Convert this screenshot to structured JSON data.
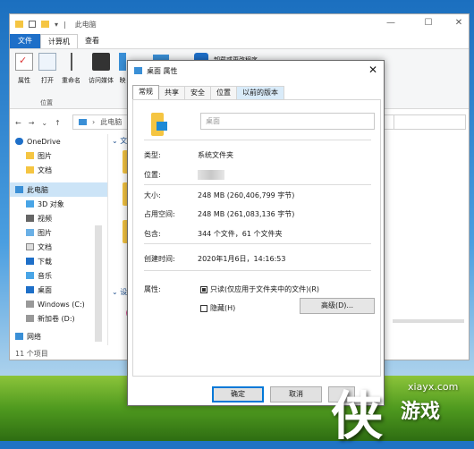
{
  "explorer": {
    "title": "此电脑",
    "tabs": [
      "文件",
      "计算机",
      "查看"
    ],
    "ribbon_buttons": [
      "属性",
      "打开",
      "重命名",
      "访问媒体",
      "映"
    ],
    "ribbon_group": "位置",
    "ribbon_right": "卸载或更改程序",
    "address": "此电脑",
    "nav_items": [
      "OneDrive",
      "图片",
      "文档",
      "此电脑",
      "3D 对象",
      "视频",
      "图片",
      "文档",
      "下载",
      "音乐",
      "桌面",
      "Windows (C:)",
      "新加卷 (D:)",
      "网络"
    ],
    "section_labels": [
      "文件",
      "设备"
    ],
    "status": "11 个项目"
  },
  "dialog": {
    "title": "桌面 属性",
    "tabs": [
      "常规",
      "共享",
      "安全",
      "位置",
      "以前的版本"
    ],
    "name": "桌面",
    "labels": {
      "type": "类型:",
      "location": "位置:",
      "size": "大小:",
      "size_on_disk": "占用空间:",
      "contains": "包含:",
      "created": "创建时间:",
      "attributes": "属性:"
    },
    "values": {
      "type": "系统文件夹",
      "size": "248 MB (260,406,799 字节)",
      "size_on_disk": "248 MB (261,083,136 字节)",
      "contains": "344 个文件，61 个文件夹",
      "created": "2020年1月6日，14:16:53"
    },
    "readonly_label": "只读(仅应用于文件夹中的文件)(R)",
    "readonly_checked": true,
    "hidden_label": "隐藏(H)",
    "hidden_checked": false,
    "advanced_button": "高级(D)...",
    "ok_button": "确定",
    "cancel_button": "取消"
  },
  "watermark": {
    "glyph": "侠",
    "site": "xiayx.com",
    "name": "游戏"
  },
  "colors": {
    "accent": "#1e6fc8",
    "folder": "#f5c542",
    "selection": "#cce4f7"
  }
}
